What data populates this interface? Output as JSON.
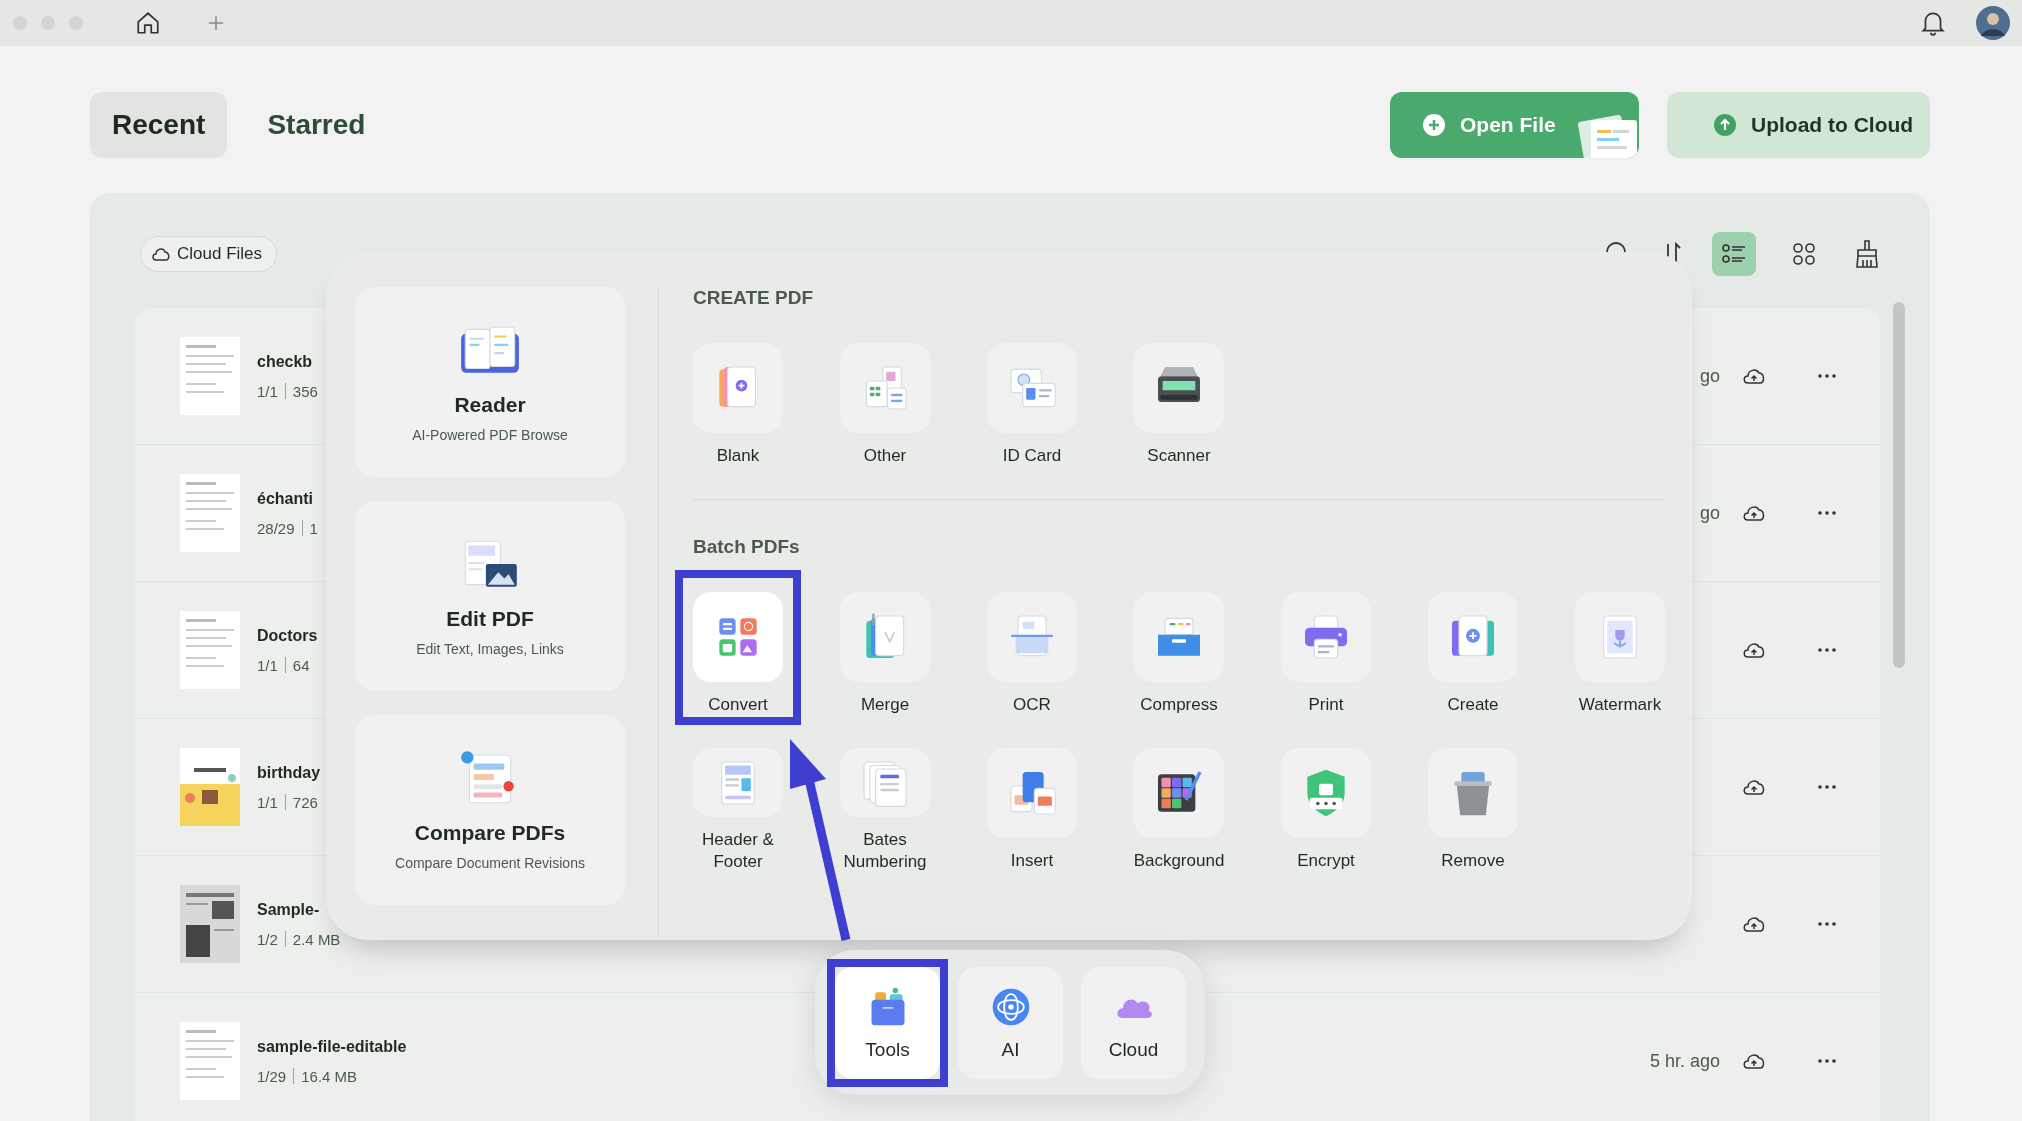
{
  "tabs": [
    {
      "label": "Recent",
      "selected": true
    },
    {
      "label": "Starred",
      "selected": false
    }
  ],
  "actions": [
    {
      "label": "Open File",
      "kind": "primary"
    },
    {
      "label": "Upload to Cloud",
      "kind": "secondary"
    }
  ],
  "cloud_files": {
    "label": "Cloud Files"
  },
  "view_modes": [
    {
      "selected": true
    },
    {
      "selected": false
    }
  ],
  "files": [
    {
      "name": "checkb",
      "pages": "1/1",
      "size": "356",
      "time": "go"
    },
    {
      "name": "échanti",
      "pages": "28/29",
      "size": "1",
      "time": "go"
    },
    {
      "name": "Doctors",
      "pages": "1/1",
      "size": "64"
    },
    {
      "name": "birthday",
      "pages": "1/1",
      "size": "726"
    },
    {
      "name": "Sample-",
      "pages": "1/2",
      "size": "2.4 MB"
    },
    {
      "name": "sample-file-editable",
      "pages": "1/29",
      "size": "16.4 MB",
      "time": "5 hr. ago"
    }
  ],
  "tools_panel": {
    "cards": [
      {
        "title": "Reader",
        "subtitle": "AI-Powered PDF Browse"
      },
      {
        "title": "Edit PDF",
        "subtitle": "Edit Text, Images, Links"
      },
      {
        "title": "Compare PDFs",
        "subtitle": "Compare Document Revisions"
      }
    ],
    "sections": [
      {
        "heading": "CREATE PDF",
        "tools": [
          {
            "label": "Blank",
            "selected": false
          },
          {
            "label": "Other",
            "selected": false
          },
          {
            "label": "ID Card",
            "selected": false
          },
          {
            "label": "Scanner",
            "selected": false
          }
        ]
      },
      {
        "heading": "Batch PDFs",
        "tools": [
          {
            "label": "Convert",
            "selected": true
          },
          {
            "label": "Merge",
            "selected": false
          },
          {
            "label": "OCR",
            "selected": false
          },
          {
            "label": "Compress",
            "selected": false
          },
          {
            "label": "Print",
            "selected": false
          },
          {
            "label": "Create",
            "selected": false
          },
          {
            "label": "Watermark",
            "selected": false
          },
          {
            "label": "Header & Footer",
            "selected": false
          },
          {
            "label": "Bates Numbering",
            "selected": false
          },
          {
            "label": "Insert",
            "selected": false
          },
          {
            "label": "Background",
            "selected": false
          },
          {
            "label": "Encrypt",
            "selected": false
          },
          {
            "label": "Remove",
            "selected": false
          }
        ]
      }
    ]
  },
  "dock": [
    {
      "label": "Tools",
      "selected": true
    },
    {
      "label": "AI",
      "selected": false
    },
    {
      "label": "Cloud",
      "selected": false
    }
  ]
}
